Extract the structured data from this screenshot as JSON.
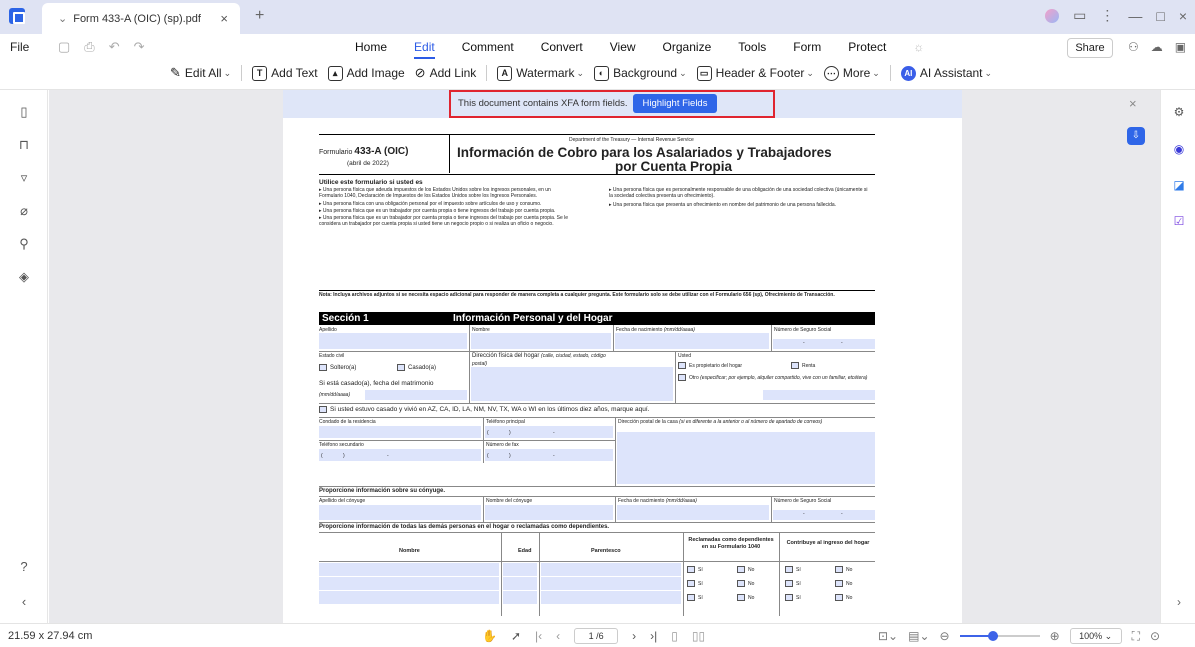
{
  "window": {
    "tab_title": "Form 433-A (OIC) (sp).pdf",
    "tab_close": "×",
    "new_tab": "+",
    "controls": [
      "—",
      "□",
      "×"
    ]
  },
  "menubar": {
    "file": "File",
    "tabs": [
      "Home",
      "Edit",
      "Comment",
      "Convert",
      "View",
      "Organize",
      "Tools",
      "Form",
      "Protect"
    ],
    "active_tab": "Edit",
    "share": "Share"
  },
  "toolbar": {
    "edit_all": "Edit All",
    "add_text": "Add Text",
    "add_image": "Add Image",
    "add_link": "Add Link",
    "watermark": "Watermark",
    "background": "Background",
    "header_footer": "Header & Footer",
    "more": "More",
    "ai_assistant": "AI Assistant"
  },
  "xfa_notice": {
    "message": "This document contains XFA form fields.",
    "button": "Highlight Fields",
    "close": "×"
  },
  "form": {
    "form_label": "Formulario",
    "form_number": "433-A (OIC)",
    "form_date": "(abril de 2022)",
    "dept": "Department of the Treasury — Internal Revenue Service",
    "title_line1": "Información de Cobro para los Asalariados y Trabajadores",
    "title_line2": "por Cuenta Propia",
    "use_heading": "Utilice este formulario si usted es",
    "bullets_left": [
      "Una persona física que adeuda impuestos de los Estados Unidos sobre los ingresos personales, en un Formulario 1040, Declaración de Impuestos de los Estados Unidos sobre los Ingresos Personales.",
      "Una persona física con una obligación personal por el impuesto sobre artículos de uso y consumo.",
      "Una persona física que es un trabajador por cuenta propia o tiene ingresos del trabajo por cuenta propia.",
      "Una persona física que es un trabajador por cuenta propia o tiene ingresos del trabajo por cuenta propia. Se le considera un trabajador por cuenta propia si usted tiene un negocio propio o si realiza un oficio o negocio."
    ],
    "bullets_right": [
      "Una persona física que es personalmente responsable de una obligación de una sociedad colectiva (únicamente si la sociedad colectiva presenta un ofrecimiento).",
      "Una persona física que presenta un ofrecimiento en nombre del patrimonio de una persona fallecida."
    ],
    "note": "Nota: Incluya archivos adjuntos si se necesita espacio adicional para responder de manera completa a cualquier pregunta. Este formulario solo se debe utilizar con el Formulario 656 (sp), Ofrecimiento de Transacción.",
    "section_label": "Sección 1",
    "section_title": "Información Personal y del Hogar",
    "apellido": "Apellido",
    "nombre": "Nombre",
    "fecha_nac": "Fecha de nacimiento",
    "fecha_fmt": "(mm/dd/aaaa)",
    "ssn": "Número de Seguro Social",
    "estado_civil": "Estado civil",
    "soltero": "Soltero(a)",
    "casado": "Casado(a)",
    "si_casado": "Si está casado(a), fecha del matrimonio",
    "mmdd": "(mm/dd/aaaa)",
    "direccion": "Dirección física del hogar",
    "direccion_note": "(calle, ciudad, estado, código postal)",
    "usted": "Usted",
    "propietario": "Es propietario del hogar",
    "renta": "Renta",
    "otro": "Otro",
    "otro_note": "(especificar; por ejemplo, alquiler compartido, vive con un familiar, etcétera)",
    "states_line": "Si usted estuvo casado y vivió en AZ, CA, ID, LA, NM, NV, TX, WA o WI en los últimos diez años, marque aquí.",
    "condado": "Condado de la residencia",
    "tel_principal": "Teléfono principal",
    "direccion_postal": "Dirección postal de la casa",
    "direccion_postal_note": "(si es diferente a la anterior o al número de apartado de correos)",
    "tel_secundario": "Teléfono secundario",
    "fax": "Número de fax",
    "conyuge_heading": "Proporcione información sobre su cónyuge.",
    "apellido_conyuge": "Apellido del cónyuge",
    "nombre_conyuge": "Nombre del cónyuge",
    "hogar_heading": "Proporcione información de todas las demás personas en el hogar o reclamadas como dependientes.",
    "col_nombre": "Nombre",
    "col_edad": "Edad",
    "col_parentesco": "Parentesco",
    "col_reclamadas": "Reclamadas como dependientes en su Formulario 1040",
    "col_contribuye": "Contribuye al ingreso del hogar",
    "si": "Sí",
    "no": "No",
    "paren_open": "(",
    "paren_close": ")",
    "dash": "-"
  },
  "status": {
    "dimensions": "21.59 x 27.94 cm",
    "page": "1 /6",
    "zoom": "100%"
  }
}
